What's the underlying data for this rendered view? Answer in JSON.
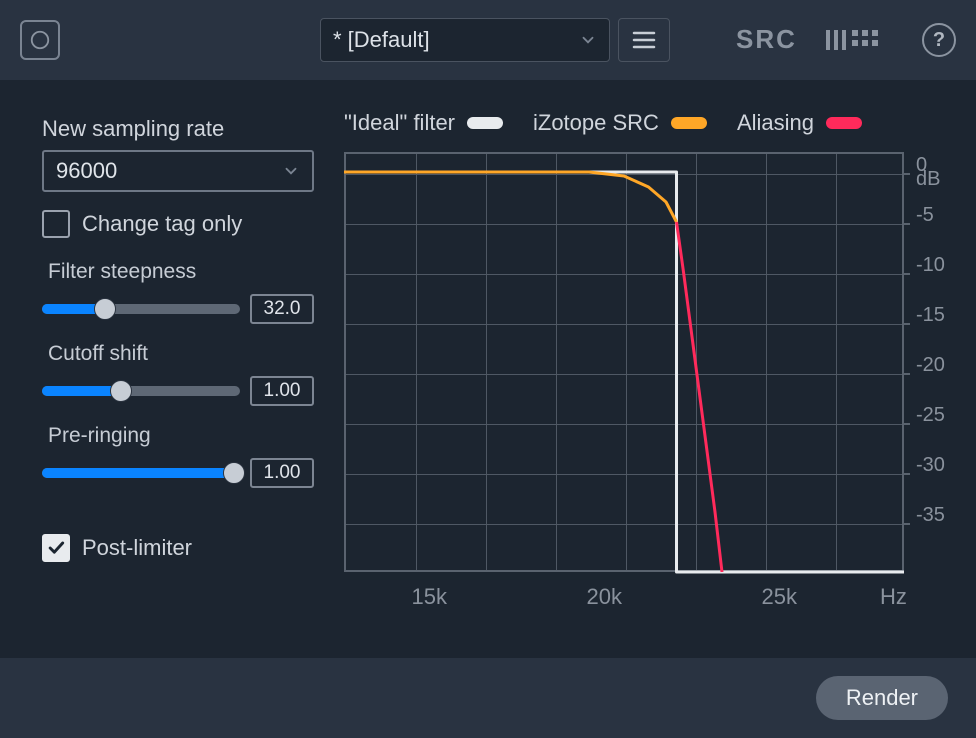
{
  "topbar": {
    "preset_label": "* [Default]",
    "brand": "SRC",
    "help": "?"
  },
  "params": {
    "sampling_rate_label": "New sampling rate",
    "sampling_rate_value": "96000",
    "change_tag_only_label": "Change tag only",
    "change_tag_only_checked": false,
    "filter_steepness_label": "Filter steepness",
    "filter_steepness_value": "32.0",
    "filter_steepness_pct": 32,
    "cutoff_shift_label": "Cutoff shift",
    "cutoff_shift_value": "1.00",
    "cutoff_shift_pct": 40,
    "pre_ringing_label": "Pre-ringing",
    "pre_ringing_value": "1.00",
    "pre_ringing_pct": 100,
    "post_limiter_label": "Post-limiter",
    "post_limiter_checked": true
  },
  "legend": {
    "ideal": "\"Ideal\" filter",
    "izotope": "iZotope SRC",
    "aliasing": "Aliasing",
    "colors": {
      "ideal": "#e8ebee",
      "izotope": "#ffa727",
      "aliasing": "#ff2a5b"
    }
  },
  "chart_data": {
    "type": "line",
    "xlabel": "Hz",
    "ylabel": "dB",
    "xlim": [
      12500,
      28500
    ],
    "ylim": [
      -40,
      2
    ],
    "x_ticks": [
      15000,
      20000,
      25000
    ],
    "x_tick_labels": [
      "15k",
      "20k",
      "25k"
    ],
    "y_ticks": [
      0,
      -5,
      -10,
      -15,
      -20,
      -25,
      -30,
      -35
    ],
    "y_tick_labels": [
      "0",
      "-5",
      "-10",
      "-15",
      "-20",
      "-25",
      "-30",
      "-35"
    ],
    "series": [
      {
        "name": "Ideal filter",
        "color": "#e8ebee",
        "x": [
          12500,
          22000,
          22000.1,
          28500
        ],
        "y": [
          0,
          0,
          -40,
          -40
        ]
      },
      {
        "name": "iZotope SRC",
        "color": "#ffa727",
        "x": [
          12500,
          19500,
          20500,
          21200,
          21700,
          22000
        ],
        "y": [
          0,
          0,
          -0.4,
          -1.5,
          -3.0,
          -5.0
        ]
      },
      {
        "name": "Aliasing",
        "color": "#ff2a5b",
        "x": [
          22000,
          22200,
          22500,
          22800,
          23100,
          23300
        ],
        "y": [
          -5.0,
          -10,
          -18,
          -26,
          -34,
          -40
        ]
      }
    ]
  },
  "footer": {
    "render_label": "Render"
  }
}
